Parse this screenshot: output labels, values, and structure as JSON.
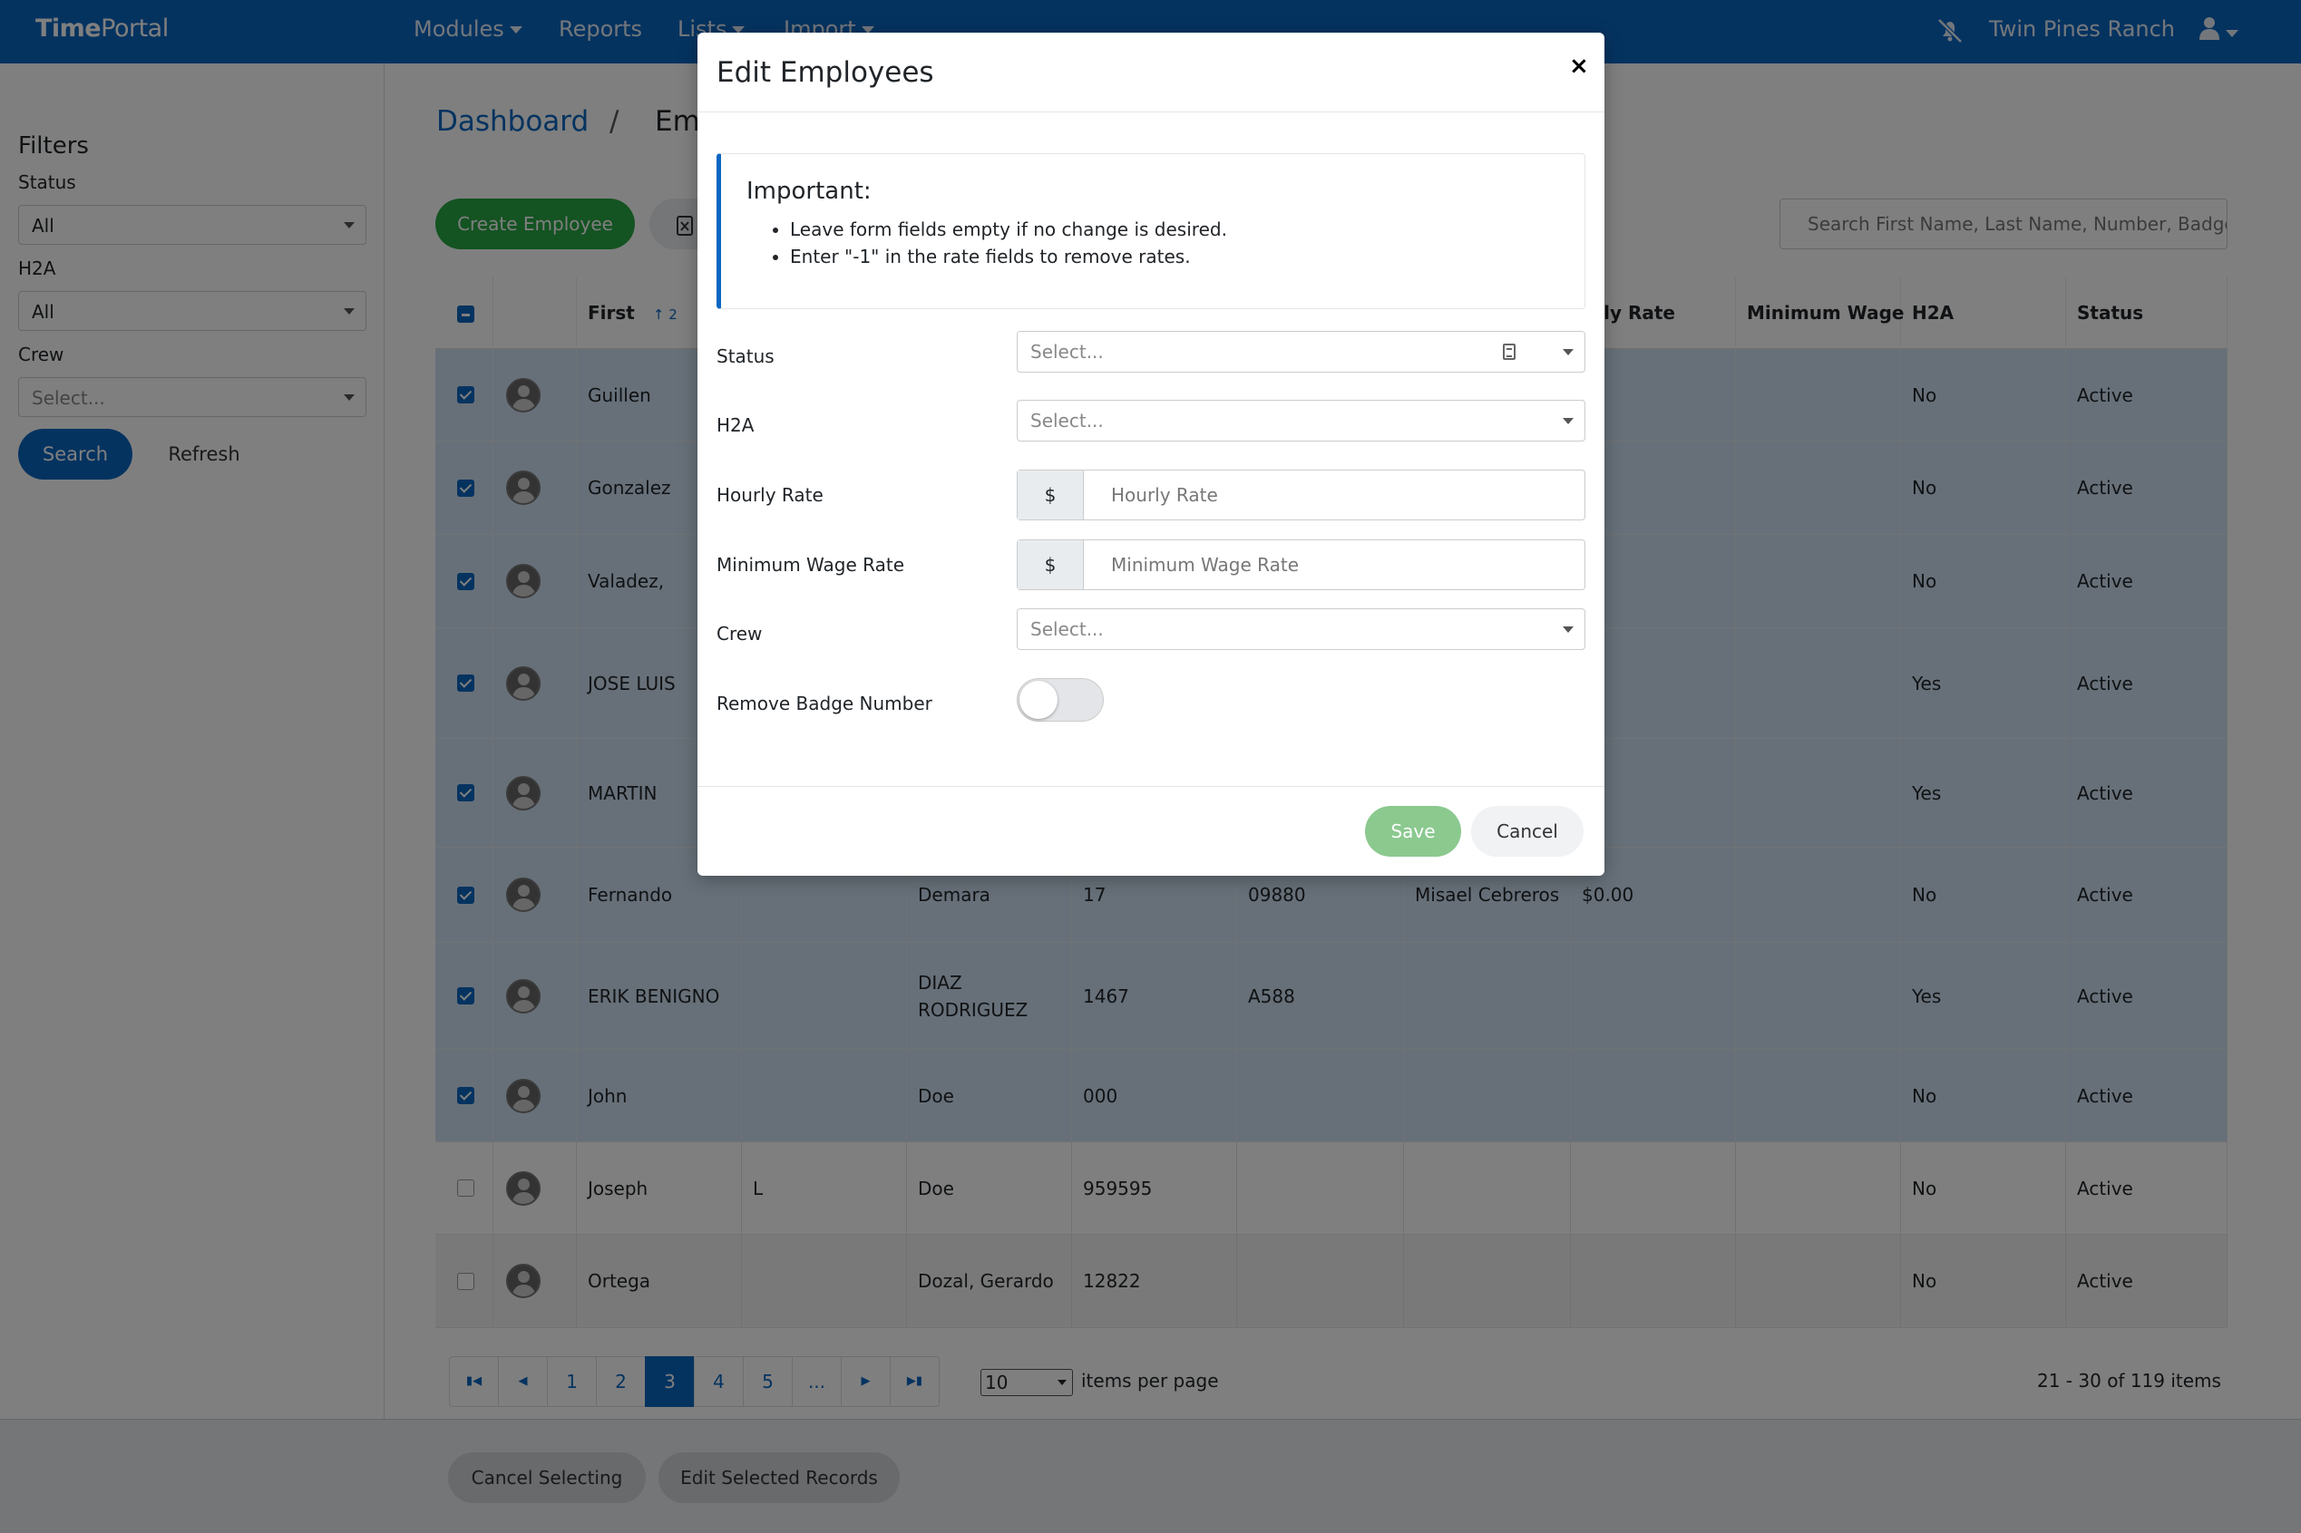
{
  "navbar": {
    "brand_bold": "Time",
    "brand_rest": "Portal",
    "items": [
      {
        "label": "Modules"
      },
      {
        "label": "Reports"
      },
      {
        "label": "Lists"
      },
      {
        "label": "Import"
      }
    ],
    "company": "Twin Pines Ranch",
    "bell_off_icon": "bell-slash-icon",
    "user_icon": "user-icon",
    "accent_color": "#0b66c1"
  },
  "sidebar": {
    "title": "Filters",
    "status_label": "Status",
    "status_value": "All",
    "h2a_label": "H2A",
    "h2a_value": "All",
    "crew_label": "Crew",
    "crew_placeholder": "Select...",
    "search_button": "Search",
    "refresh_button": "Refresh"
  },
  "breadcrumb": {
    "home": "Dashboard",
    "separator": "/",
    "current": "Em"
  },
  "toolbar": {
    "create_button": "Create Employee",
    "export_icon": "file-excel-icon",
    "search_placeholder": "Search First Name, Last Name, Number, Badge.."
  },
  "grid": {
    "columns": {
      "first": "First",
      "first_sort": "2",
      "hourly_rate": "urly Rate",
      "minimum_wage": "Minimum Wage",
      "h2a": "H2A",
      "status": "Status"
    },
    "rows": [
      {
        "selected": true,
        "first": "Guillen",
        "middle": "",
        "last": "",
        "number": "",
        "badge": "",
        "crew": "",
        "rate": "",
        "h2a": "No",
        "status": "Active"
      },
      {
        "selected": true,
        "first": "Gonzalez",
        "middle": "",
        "last": "",
        "number": "",
        "badge": "",
        "crew": "",
        "rate": "",
        "h2a": "No",
        "status": "Active"
      },
      {
        "selected": true,
        "first": "Valadez,",
        "middle": "",
        "last": "",
        "number": "",
        "badge": "",
        "crew": "",
        "rate": "",
        "h2a": "No",
        "status": "Active"
      },
      {
        "selected": true,
        "first": "JOSE LUIS",
        "middle": "",
        "last": "",
        "number": "",
        "badge": "",
        "crew": "",
        "rate": "",
        "h2a": "Yes",
        "status": "Active"
      },
      {
        "selected": true,
        "first": "MARTIN",
        "middle": "",
        "last": "",
        "number": "",
        "badge": "",
        "crew": "",
        "rate": "",
        "h2a": "Yes",
        "status": "Active"
      },
      {
        "selected": true,
        "first": "Fernando",
        "middle": "",
        "last": "Demara",
        "number": "17",
        "badge": "09880",
        "crew": "Misael Cebreros",
        "rate": "$0.00",
        "h2a": "No",
        "status": "Active"
      },
      {
        "selected": true,
        "first": "ERIK BENIGNO",
        "middle": "",
        "last": "DIAZ",
        "last2": "RODRIGUEZ",
        "number": "1467",
        "badge": "A588",
        "crew": "",
        "rate": "",
        "h2a": "Yes",
        "status": "Active"
      },
      {
        "selected": true,
        "first": "John",
        "middle": "",
        "last": "Doe",
        "number": "000",
        "badge": "",
        "crew": "",
        "rate": "",
        "h2a": "No",
        "status": "Active"
      },
      {
        "selected": false,
        "first": "Joseph",
        "middle": "L",
        "last": "Doe",
        "number": "959595",
        "badge": "",
        "crew": "",
        "rate": "",
        "h2a": "No",
        "status": "Active"
      },
      {
        "selected": false,
        "first": "Ortega",
        "middle": "",
        "last": "Dozal, Gerardo",
        "number": "12822",
        "badge": "",
        "crew": "",
        "rate": "",
        "h2a": "No",
        "status": "Active"
      }
    ]
  },
  "pager": {
    "pages": [
      "1",
      "2",
      "3",
      "4",
      "5",
      "..."
    ],
    "current_page": "3",
    "per_page": "10",
    "per_page_label": "items per page",
    "range": "21 - 30 of 119 items"
  },
  "footer": {
    "cancel_selecting": "Cancel Selecting",
    "edit_selected": "Edit Selected Records"
  },
  "modal": {
    "title": "Edit Employees",
    "close": "×",
    "important_title": "Important:",
    "notes": [
      "Leave form fields empty if no change is desired.",
      "Enter \"-1\" in the rate fields to remove rates."
    ],
    "status_label": "Status",
    "status_placeholder": "Select...",
    "h2a_label": "H2A",
    "h2a_placeholder": "Select...",
    "hourly_label": "Hourly Rate",
    "hourly_addon": "$",
    "hourly_placeholder": "Hourly Rate",
    "hourly_value": "",
    "minwage_label": "Minimum Wage Rate",
    "minwage_addon": "$",
    "minwage_placeholder": "Minimum Wage Rate",
    "minwage_value": "",
    "crew_label": "Crew",
    "crew_placeholder": "Select...",
    "remove_badge_label": "Remove Badge Number",
    "remove_badge_on": false,
    "save_button": "Save",
    "cancel_button": "Cancel"
  }
}
